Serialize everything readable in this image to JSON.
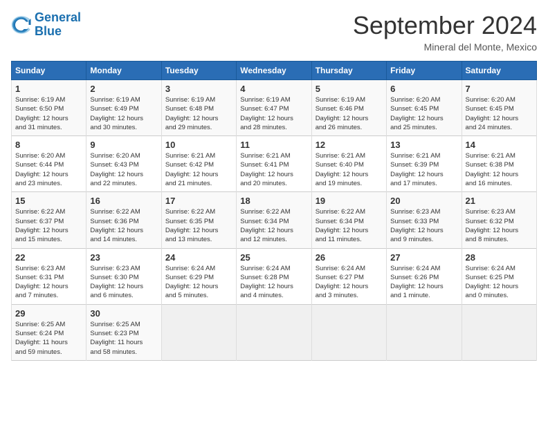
{
  "logo": {
    "line1": "General",
    "line2": "Blue"
  },
  "title": "September 2024",
  "subtitle": "Mineral del Monte, Mexico",
  "days_of_week": [
    "Sunday",
    "Monday",
    "Tuesday",
    "Wednesday",
    "Thursday",
    "Friday",
    "Saturday"
  ],
  "weeks": [
    [
      {
        "day": "1",
        "info": "Sunrise: 6:19 AM\nSunset: 6:50 PM\nDaylight: 12 hours\nand 31 minutes."
      },
      {
        "day": "2",
        "info": "Sunrise: 6:19 AM\nSunset: 6:49 PM\nDaylight: 12 hours\nand 30 minutes."
      },
      {
        "day": "3",
        "info": "Sunrise: 6:19 AM\nSunset: 6:48 PM\nDaylight: 12 hours\nand 29 minutes."
      },
      {
        "day": "4",
        "info": "Sunrise: 6:19 AM\nSunset: 6:47 PM\nDaylight: 12 hours\nand 28 minutes."
      },
      {
        "day": "5",
        "info": "Sunrise: 6:19 AM\nSunset: 6:46 PM\nDaylight: 12 hours\nand 26 minutes."
      },
      {
        "day": "6",
        "info": "Sunrise: 6:20 AM\nSunset: 6:45 PM\nDaylight: 12 hours\nand 25 minutes."
      },
      {
        "day": "7",
        "info": "Sunrise: 6:20 AM\nSunset: 6:45 PM\nDaylight: 12 hours\nand 24 minutes."
      }
    ],
    [
      {
        "day": "8",
        "info": "Sunrise: 6:20 AM\nSunset: 6:44 PM\nDaylight: 12 hours\nand 23 minutes."
      },
      {
        "day": "9",
        "info": "Sunrise: 6:20 AM\nSunset: 6:43 PM\nDaylight: 12 hours\nand 22 minutes."
      },
      {
        "day": "10",
        "info": "Sunrise: 6:21 AM\nSunset: 6:42 PM\nDaylight: 12 hours\nand 21 minutes."
      },
      {
        "day": "11",
        "info": "Sunrise: 6:21 AM\nSunset: 6:41 PM\nDaylight: 12 hours\nand 20 minutes."
      },
      {
        "day": "12",
        "info": "Sunrise: 6:21 AM\nSunset: 6:40 PM\nDaylight: 12 hours\nand 19 minutes."
      },
      {
        "day": "13",
        "info": "Sunrise: 6:21 AM\nSunset: 6:39 PM\nDaylight: 12 hours\nand 17 minutes."
      },
      {
        "day": "14",
        "info": "Sunrise: 6:21 AM\nSunset: 6:38 PM\nDaylight: 12 hours\nand 16 minutes."
      }
    ],
    [
      {
        "day": "15",
        "info": "Sunrise: 6:22 AM\nSunset: 6:37 PM\nDaylight: 12 hours\nand 15 minutes."
      },
      {
        "day": "16",
        "info": "Sunrise: 6:22 AM\nSunset: 6:36 PM\nDaylight: 12 hours\nand 14 minutes."
      },
      {
        "day": "17",
        "info": "Sunrise: 6:22 AM\nSunset: 6:35 PM\nDaylight: 12 hours\nand 13 minutes."
      },
      {
        "day": "18",
        "info": "Sunrise: 6:22 AM\nSunset: 6:34 PM\nDaylight: 12 hours\nand 12 minutes."
      },
      {
        "day": "19",
        "info": "Sunrise: 6:22 AM\nSunset: 6:34 PM\nDaylight: 12 hours\nand 11 minutes."
      },
      {
        "day": "20",
        "info": "Sunrise: 6:23 AM\nSunset: 6:33 PM\nDaylight: 12 hours\nand 9 minutes."
      },
      {
        "day": "21",
        "info": "Sunrise: 6:23 AM\nSunset: 6:32 PM\nDaylight: 12 hours\nand 8 minutes."
      }
    ],
    [
      {
        "day": "22",
        "info": "Sunrise: 6:23 AM\nSunset: 6:31 PM\nDaylight: 12 hours\nand 7 minutes."
      },
      {
        "day": "23",
        "info": "Sunrise: 6:23 AM\nSunset: 6:30 PM\nDaylight: 12 hours\nand 6 minutes."
      },
      {
        "day": "24",
        "info": "Sunrise: 6:24 AM\nSunset: 6:29 PM\nDaylight: 12 hours\nand 5 minutes."
      },
      {
        "day": "25",
        "info": "Sunrise: 6:24 AM\nSunset: 6:28 PM\nDaylight: 12 hours\nand 4 minutes."
      },
      {
        "day": "26",
        "info": "Sunrise: 6:24 AM\nSunset: 6:27 PM\nDaylight: 12 hours\nand 3 minutes."
      },
      {
        "day": "27",
        "info": "Sunrise: 6:24 AM\nSunset: 6:26 PM\nDaylight: 12 hours\nand 1 minute."
      },
      {
        "day": "28",
        "info": "Sunrise: 6:24 AM\nSunset: 6:25 PM\nDaylight: 12 hours\nand 0 minutes."
      }
    ],
    [
      {
        "day": "29",
        "info": "Sunrise: 6:25 AM\nSunset: 6:24 PM\nDaylight: 11 hours\nand 59 minutes."
      },
      {
        "day": "30",
        "info": "Sunrise: 6:25 AM\nSunset: 6:23 PM\nDaylight: 11 hours\nand 58 minutes."
      },
      {
        "day": "",
        "info": ""
      },
      {
        "day": "",
        "info": ""
      },
      {
        "day": "",
        "info": ""
      },
      {
        "day": "",
        "info": ""
      },
      {
        "day": "",
        "info": ""
      }
    ]
  ]
}
